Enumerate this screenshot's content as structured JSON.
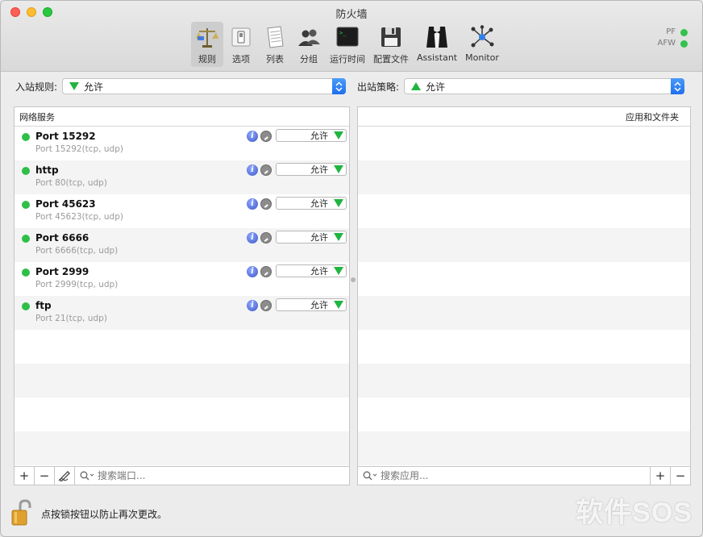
{
  "window": {
    "title": "防火墙"
  },
  "toolbar": {
    "items": [
      {
        "label": "规则",
        "icon": "scales-icon",
        "active": true
      },
      {
        "label": "选项",
        "icon": "switch-icon",
        "active": false
      },
      {
        "label": "列表",
        "icon": "document-list-icon",
        "active": false
      },
      {
        "label": "分组",
        "icon": "group-users-icon",
        "active": false
      },
      {
        "label": "运行时间",
        "icon": "terminal-icon",
        "active": false
      },
      {
        "label": "配置文件",
        "icon": "floppy-disk-icon",
        "active": false
      },
      {
        "label": "Assistant",
        "icon": "tuxedo-icon",
        "active": false
      },
      {
        "label": "Monitor",
        "icon": "network-monitor-icon",
        "active": false
      }
    ]
  },
  "status": {
    "pf": "PF",
    "afw": "AFW",
    "color": "#32c24d"
  },
  "policy": {
    "inbound_label": "入站规则:",
    "inbound_value": "允许",
    "outbound_label": "出站策略:",
    "outbound_value": "允许"
  },
  "left_panel": {
    "header": "网络服务",
    "services": [
      {
        "name": "Port 15292",
        "detail": "Port 15292(tcp, udp)",
        "action": "允许"
      },
      {
        "name": "http",
        "detail": "Port 80(tcp, udp)",
        "action": "允许"
      },
      {
        "name": "Port 45623",
        "detail": "Port 45623(tcp, udp)",
        "action": "允许"
      },
      {
        "name": "Port 6666",
        "detail": "Port 6666(tcp, udp)",
        "action": "允许"
      },
      {
        "name": "Port 2999",
        "detail": "Port 2999(tcp, udp)",
        "action": "允许"
      },
      {
        "name": "ftp",
        "detail": "Port 21(tcp, udp)",
        "action": "允许"
      }
    ],
    "search_placeholder": "搜索端口..."
  },
  "right_panel": {
    "header": "应用和文件夹",
    "search_placeholder": "搜索应用..."
  },
  "footer": {
    "lock_text": "点按锁按钮以防止再次更改。"
  },
  "watermark": "软件SOS",
  "colors": {
    "allow_green": "#1fb540",
    "accent_blue": "#1f6ff0",
    "active_dot": "#2fbf48"
  }
}
